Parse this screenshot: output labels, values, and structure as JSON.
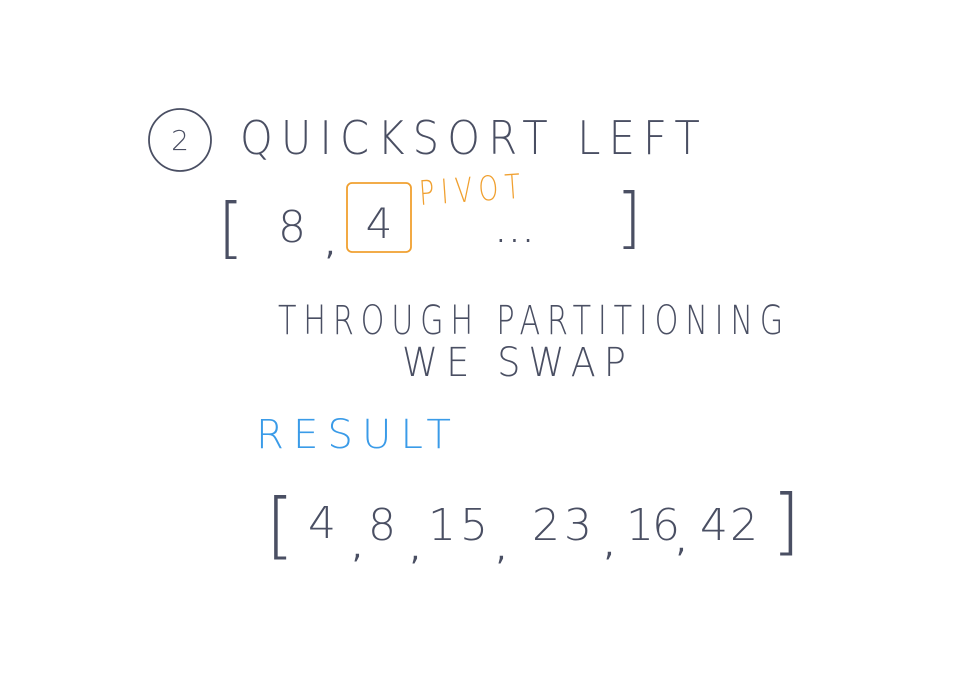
{
  "colors": {
    "ink": "#4a4f63",
    "pivot": "#f0a030",
    "result": "#3a9be8",
    "background": "#ffffff"
  },
  "step": {
    "number": "2",
    "title": "QUICKSORT LEFT"
  },
  "initial_array": {
    "open_bracket": "[",
    "first_value": "8",
    "pivot_value": "4",
    "ellipsis": "...",
    "close_bracket": "]"
  },
  "pivot_label": "PIVOT",
  "explanation": {
    "line1": "THROUGH PARTITIONING",
    "line2": "WE SWAP"
  },
  "result_label": "RESULT",
  "result_array": {
    "open_bracket": "[",
    "values": [
      "4",
      "8",
      "15",
      "23",
      "16",
      "42"
    ],
    "close_bracket": "]"
  }
}
